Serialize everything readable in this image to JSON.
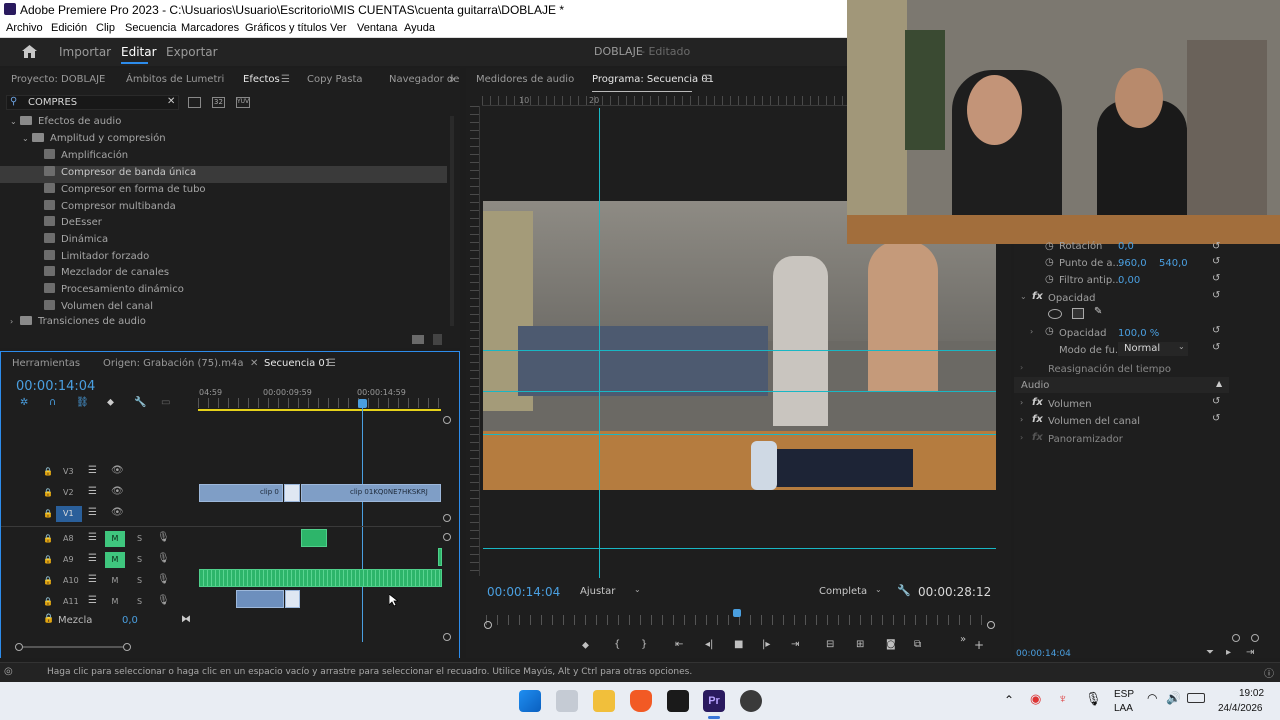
{
  "window": {
    "title": "Adobe Premiere Pro 2023 - C:\\Usuarios\\Usuario\\Escritorio\\MIS CUENTAS\\cuenta guitarra\\DOBLAJE *"
  },
  "menu": [
    "Archivo",
    "Edición",
    "Clip",
    "Secuencia",
    "Marcadores",
    "Gráficos y títulos",
    "Ver",
    "Ventana",
    "Ayuda"
  ],
  "workspaces": {
    "import": "Importar",
    "edit": "Editar",
    "export": "Exportar",
    "project_title": "DOBLAJE",
    "project_status": "- Editado"
  },
  "effects_panel": {
    "tabs": [
      "Proyecto: DOBLAJE",
      "Ámbitos de Lumetri",
      "Efectos",
      "Copy Pasta",
      "Navegador de"
    ],
    "search_value": "COMPRES",
    "tree": [
      {
        "label": "Efectos de audio",
        "type": "folder",
        "indent": 0
      },
      {
        "label": "Amplitud y compresión",
        "type": "folder",
        "indent": 1
      },
      {
        "label": "Amplificación",
        "type": "fx",
        "indent": 2
      },
      {
        "label": "Compresor de banda única",
        "type": "fx",
        "indent": 2,
        "selected": true
      },
      {
        "label": "Compresor en forma de tubo",
        "type": "fx",
        "indent": 2
      },
      {
        "label": "Compresor multibanda",
        "type": "fx",
        "indent": 2
      },
      {
        "label": "DeEsser",
        "type": "fx",
        "indent": 2
      },
      {
        "label": "Dinámica",
        "type": "fx",
        "indent": 2
      },
      {
        "label": "Limitador forzado",
        "type": "fx",
        "indent": 2
      },
      {
        "label": "Mezclador de canales",
        "type": "fx",
        "indent": 2
      },
      {
        "label": "Procesamiento dinámico",
        "type": "fx",
        "indent": 2
      },
      {
        "label": "Volumen del canal",
        "type": "fx",
        "indent": 2
      },
      {
        "label": "Transiciones de audio",
        "type": "folder",
        "indent": 0
      }
    ]
  },
  "timeline": {
    "tabs": [
      "Herramientas",
      "Origen: Grabación (75).m4a",
      "Secuencia 01"
    ],
    "timecode": "00:00:14:04",
    "ruler": [
      "04:59",
      "00:00:09:59",
      "00:00:14:59"
    ],
    "tracks": [
      {
        "name": "V3",
        "m": "",
        "s": ""
      },
      {
        "name": "V2",
        "m": "",
        "s": ""
      },
      {
        "name": "V1",
        "m": "",
        "s": ""
      },
      {
        "name": "A8",
        "m": "M",
        "s": "S"
      },
      {
        "name": "A9",
        "m": "M",
        "s": "S"
      },
      {
        "name": "A10",
        "m": "M",
        "s": "S"
      },
      {
        "name": "A11",
        "m": "M",
        "s": "S"
      }
    ],
    "clips": {
      "c1": "clip 0",
      "c2": "clip 01KQ0NE7HKSKRJ"
    },
    "mix_label": "Mezcla",
    "mix_value": "0,0"
  },
  "program": {
    "tabs": [
      "Medidores de audio",
      "Programa: Secuencia 01"
    ],
    "ruler_marks": [
      "10",
      "20"
    ],
    "timecode": "00:00:14:04",
    "fit": "Ajustar",
    "quality": "Completa",
    "duration": "00:00:28:12"
  },
  "effect_controls": {
    "rotation_label": "Rotación",
    "rotation_value": "0,0",
    "anchor_label": "Punto de a...",
    "anchor_x": "960,0",
    "anchor_y": "540,0",
    "antiflicker_label": "Filtro antip...",
    "antiflicker_value": "0,00",
    "opacity_section": "Opacidad",
    "opacity_label": "Opacidad",
    "opacity_value": "100,0 %",
    "blend_label": "Modo de fu...",
    "blend_value": "Normal",
    "time_remap": "Reasignación del tiempo",
    "audio_section": "Audio",
    "volume": "Volumen",
    "channel_volume": "Volumen del canal",
    "panner": "Panoramizador",
    "footer_time": "00:00:14:04"
  },
  "status": {
    "text": "Haga clic para seleccionar o haga clic en un espacio vacío y arrastre para seleccionar el recuadro. Utilice Mayús, Alt y Ctrl para otras opciones."
  },
  "taskbar": {
    "lang1": "ESP",
    "lang2": "LAA",
    "time": "19:02",
    "date": "24/4/2026"
  }
}
